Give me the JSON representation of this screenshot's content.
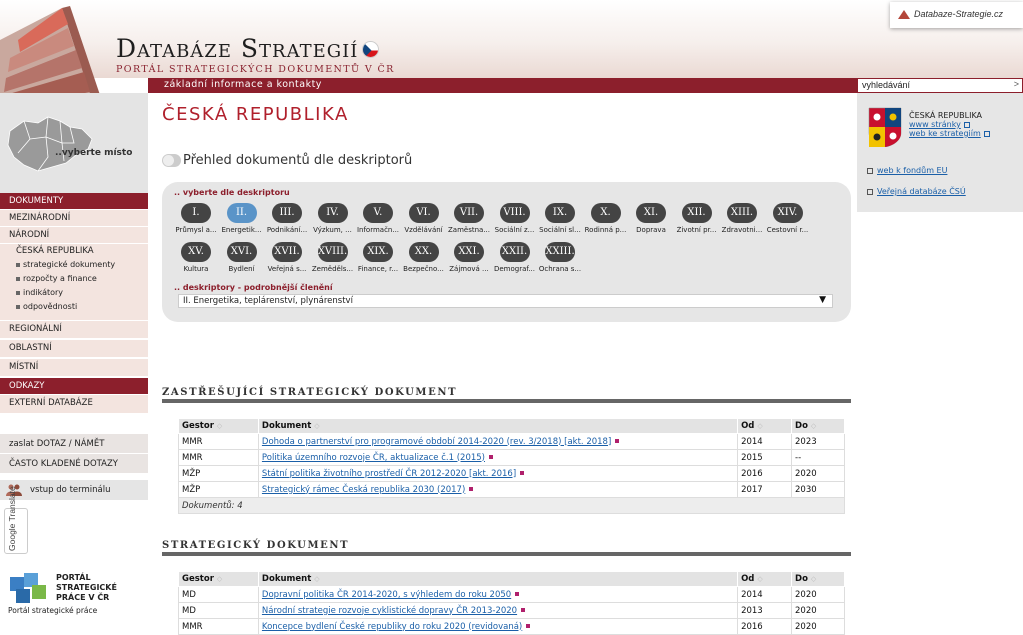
{
  "header": {
    "title": "Databáze Strategií",
    "subtitle": "PORTÁL STRATEGICKÝCH DOKUMENTŮ V ČR",
    "badge": "Databaze-Strategie.cz",
    "band_text": "základní informace a kontakty",
    "search_placeholder": "vyhledávání",
    "search_go": ">"
  },
  "sidebar": {
    "map_label": "..vyberte místo",
    "nav": {
      "dokumenty": "DOKUMENTY",
      "mezinarodni": "MEZINÁRODNÍ",
      "narodni": "NÁRODNÍ",
      "ceska_republika": "ČESKÁ REPUBLIKA",
      "sub_items": [
        "strategické dokumenty",
        "rozpočty a finance",
        "indikátory",
        "odpovědnosti"
      ],
      "regionalni": "REGIONÁLNÍ",
      "oblastni": "OBLASTNÍ",
      "mistni": "MÍSTNÍ",
      "odkazy": "ODKAZY",
      "externi": "EXTERNÍ DATABÁZE",
      "dotaz": "zaslat DOTAZ / NÁMĚT",
      "faq": "ČASTO KLADENÉ DOTAZY"
    },
    "terminal": "vstup do terminálu",
    "translate": "Google Translate",
    "psp_text": "PORTÁL STRATEGICKÉ PRÁCE V ČR",
    "psp_caption": "Portál strategické práce"
  },
  "main": {
    "page_title": "ČESKÁ REPUBLIKA",
    "overview_title": "Přehled dokumentů dle deskriptorů",
    "desc_hint": ".. vyberte dle deskriptoru",
    "descriptors": [
      {
        "num": "I.",
        "label": "Průmysl a..."
      },
      {
        "num": "II.",
        "label": "Energetik..."
      },
      {
        "num": "III.",
        "label": "Podnikání..."
      },
      {
        "num": "IV.",
        "label": "Výzkum, ..."
      },
      {
        "num": "V.",
        "label": "Informačn..."
      },
      {
        "num": "VI.",
        "label": "Vzdělávání"
      },
      {
        "num": "VII.",
        "label": "Zaměstna..."
      },
      {
        "num": "VIII.",
        "label": "Sociální z..."
      },
      {
        "num": "IX.",
        "label": "Sociální sl..."
      },
      {
        "num": "X.",
        "label": "Rodinná p..."
      },
      {
        "num": "XI.",
        "label": "Doprava"
      },
      {
        "num": "XII.",
        "label": "Životní pr..."
      },
      {
        "num": "XIII.",
        "label": "Zdravotni..."
      },
      {
        "num": "XIV.",
        "label": "Cestovní r..."
      },
      {
        "num": "XV.",
        "label": "Kultura"
      },
      {
        "num": "XVI.",
        "label": "Bydlení"
      },
      {
        "num": "XVII.",
        "label": "Veřejná s..."
      },
      {
        "num": "XVIII.",
        "label": "Zeměděls..."
      },
      {
        "num": "XIX.",
        "label": "Finance, r..."
      },
      {
        "num": "XX.",
        "label": "Bezpečno..."
      },
      {
        "num": "XXI.",
        "label": "Zájmová ..."
      },
      {
        "num": "XXII.",
        "label": "Demograf..."
      },
      {
        "num": "XXIII.",
        "label": "Ochrana s..."
      }
    ],
    "active_descriptor": "II.",
    "sub_hint": ".. deskriptory - podrobnější členění",
    "sub_select": "II. Energetika, teplárenství, plynárenství",
    "sections": [
      {
        "title": "ZASTŘEŠUJÍCÍ STRATEGICKÝ DOKUMENT",
        "headers": [
          "Gestor",
          "Dokument",
          "Od",
          "Do"
        ],
        "rows": [
          {
            "gestor": "MMR",
            "doc": "Dohoda o partnerství pro programové období 2014-2020 (rev. 3/2018) [akt. 2018]",
            "od": "2014",
            "do": "2023"
          },
          {
            "gestor": "MMR",
            "doc": "Politika územního rozvoje ČR, aktualizace č.1 (2015)",
            "od": "2015",
            "do": "--"
          },
          {
            "gestor": "MŽP",
            "doc": "Státní politika životního prostředí ČR 2012-2020 [akt. 2016]",
            "od": "2016",
            "do": "2020"
          },
          {
            "gestor": "MŽP",
            "doc": "Strategický rámec Česká republika 2030 (2017)",
            "od": "2017",
            "do": "2030"
          }
        ],
        "footer": "Dokumentů: 4"
      },
      {
        "title": "STRATEGICKÝ DOKUMENT",
        "headers": [
          "Gestor",
          "Dokument",
          "Od",
          "Do"
        ],
        "rows": [
          {
            "gestor": "MD",
            "doc": "Dopravní politika ČR 2014-2020, s výhledem do roku 2050",
            "od": "2014",
            "do": "2020"
          },
          {
            "gestor": "MD",
            "doc": "Národní strategie rozvoje cyklistické dopravy ČR 2013-2020",
            "od": "2013",
            "do": "2020"
          },
          {
            "gestor": "MMR",
            "doc": "Koncepce bydlení České republiky do roku 2020 (revidovaná)",
            "od": "2016",
            "do": "2020"
          }
        ]
      }
    ]
  },
  "rightbar": {
    "cz_name": "ČESKÁ REPUBLIKA",
    "link_www": "www stránky",
    "link_strategie": "web ke strategiím",
    "link_eu": "web k fondům EU",
    "link_csu": "Veřejná databáze ČSÚ"
  }
}
